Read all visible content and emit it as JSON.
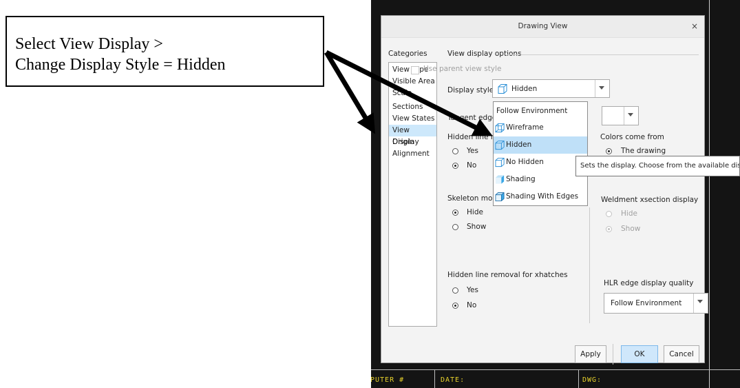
{
  "callout": {
    "line1": "Select View Display >",
    "line2": "Change Display Style = Hidden"
  },
  "background": {
    "label_left": "PUTER #",
    "label_mid": "DATE:",
    "label_right": "DWG:"
  },
  "dialog": {
    "title": "Drawing View",
    "close_glyph": "×",
    "categories_label": "Categories",
    "categories": [
      "View Type",
      "Visible Area",
      "Scale",
      "Sections",
      "View States",
      "View Display",
      "Origin",
      "Alignment"
    ],
    "selected_category": "View Display",
    "section_title": "View display options",
    "use_parent_label": "Use parent view style",
    "display_style_label": "Display style",
    "display_style_value": "Hidden",
    "tangent_label": "Tangent edge",
    "hidden_line_label": "Hidden line r",
    "yes_label": "Yes",
    "no_label": "No",
    "colors_label": "Colors come from",
    "colors_option": "The drawing",
    "skeleton_label": "Skeleton moc",
    "hide_label": "Hide",
    "show_label": "Show",
    "weldment_label": "Weldment xsection display",
    "weldment_hide": "Hide",
    "weldment_show": "Show",
    "xhatch_label": "Hidden line removal for xhatches",
    "xhatch_yes": "Yes",
    "xhatch_no": "No",
    "hlr_label": "HLR edge display quality",
    "hlr_value": "Follow Environment",
    "buttons": {
      "apply": "Apply",
      "ok": "OK",
      "cancel": "Cancel"
    }
  },
  "menu": {
    "items": [
      {
        "label": "Follow Environment",
        "icon": "none"
      },
      {
        "label": "Wireframe",
        "icon": "wireframe-cube-icon"
      },
      {
        "label": "Hidden",
        "icon": "hidden-cube-icon"
      },
      {
        "label": "No Hidden",
        "icon": "no-hidden-cube-icon"
      },
      {
        "label": "Shading",
        "icon": "shading-cube-icon"
      },
      {
        "label": "Shading With Edges",
        "icon": "shading-edges-cube-icon"
      }
    ],
    "highlighted": "Hidden"
  },
  "tooltip": {
    "text": "Sets the display.  Choose from the available display styles."
  },
  "colors": {
    "selection": "#cde8fb",
    "highlight": "#bfe0f8",
    "ok_button": "#cfe7fb",
    "icon_stroke": "#2a8fd6",
    "background_labels": "#e8d22c"
  }
}
